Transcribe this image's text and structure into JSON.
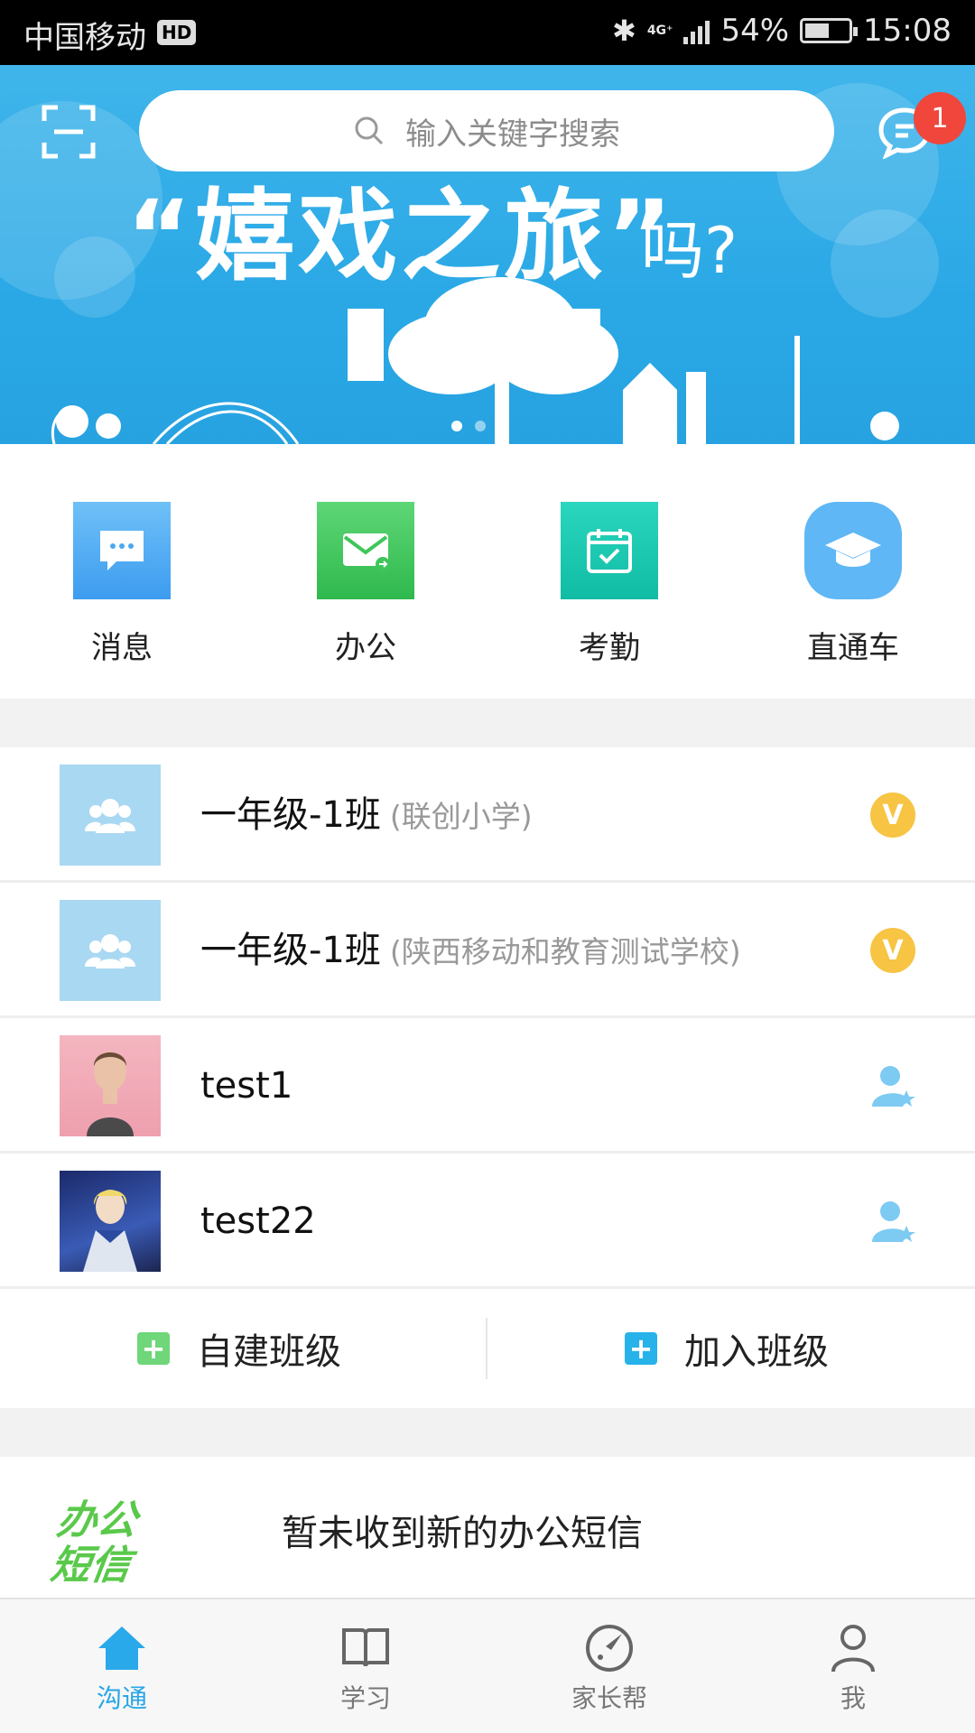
{
  "status_bar": {
    "carrier": "中国移动",
    "hd": "HD",
    "network": "4G⁺",
    "battery": "54%",
    "time": "15:08"
  },
  "banner": {
    "title": "“嬉戏之旅”",
    "subtitle": "吗?",
    "search_placeholder": "输入关键字搜索",
    "message_badge": "1",
    "carousel_active_index": 0,
    "carousel_count": 3
  },
  "quick_actions": [
    {
      "label": "消息",
      "icon": "chat-bubble-icon",
      "color": "#4aa9f0"
    },
    {
      "label": "办公",
      "icon": "envelope-icon",
      "color": "#3ec65a"
    },
    {
      "label": "考勤",
      "icon": "calendar-check-icon",
      "color": "#19c9b0"
    },
    {
      "label": "直通车",
      "icon": "graduation-cap-icon",
      "color": "#4ab0f0"
    }
  ],
  "classes": [
    {
      "name": "一年级-1班",
      "school": "(联创小学)",
      "badge": "V",
      "avatar": "group-icon"
    },
    {
      "name": "一年级-1班",
      "school": "(陕西移动和教育测试学校)",
      "badge": "V",
      "avatar": "group-icon"
    },
    {
      "name": "test1",
      "school": "",
      "badge": "user-star-icon",
      "avatar": "photo"
    },
    {
      "name": "test22",
      "school": "",
      "badge": "user-star-icon",
      "avatar": "photo"
    }
  ],
  "join": {
    "create_label": "自建班级",
    "join_label": "加入班级",
    "plus": "+"
  },
  "office_sms": {
    "logo_line1": "办公",
    "logo_line2": "短信",
    "text": "暂未收到新的办公短信"
  },
  "tabs": [
    {
      "label": "沟通",
      "icon": "home-icon",
      "active": true
    },
    {
      "label": "学习",
      "icon": "book-icon",
      "active": false
    },
    {
      "label": "家长帮",
      "icon": "compass-icon",
      "active": false
    },
    {
      "label": "我",
      "icon": "person-icon",
      "active": false
    }
  ],
  "colors": {
    "accent": "#27a6e6",
    "banner": "#2aa8e6",
    "badge_red": "#f0463c",
    "vip_gold": "#f7c443",
    "create_green": "#6fd67a"
  }
}
